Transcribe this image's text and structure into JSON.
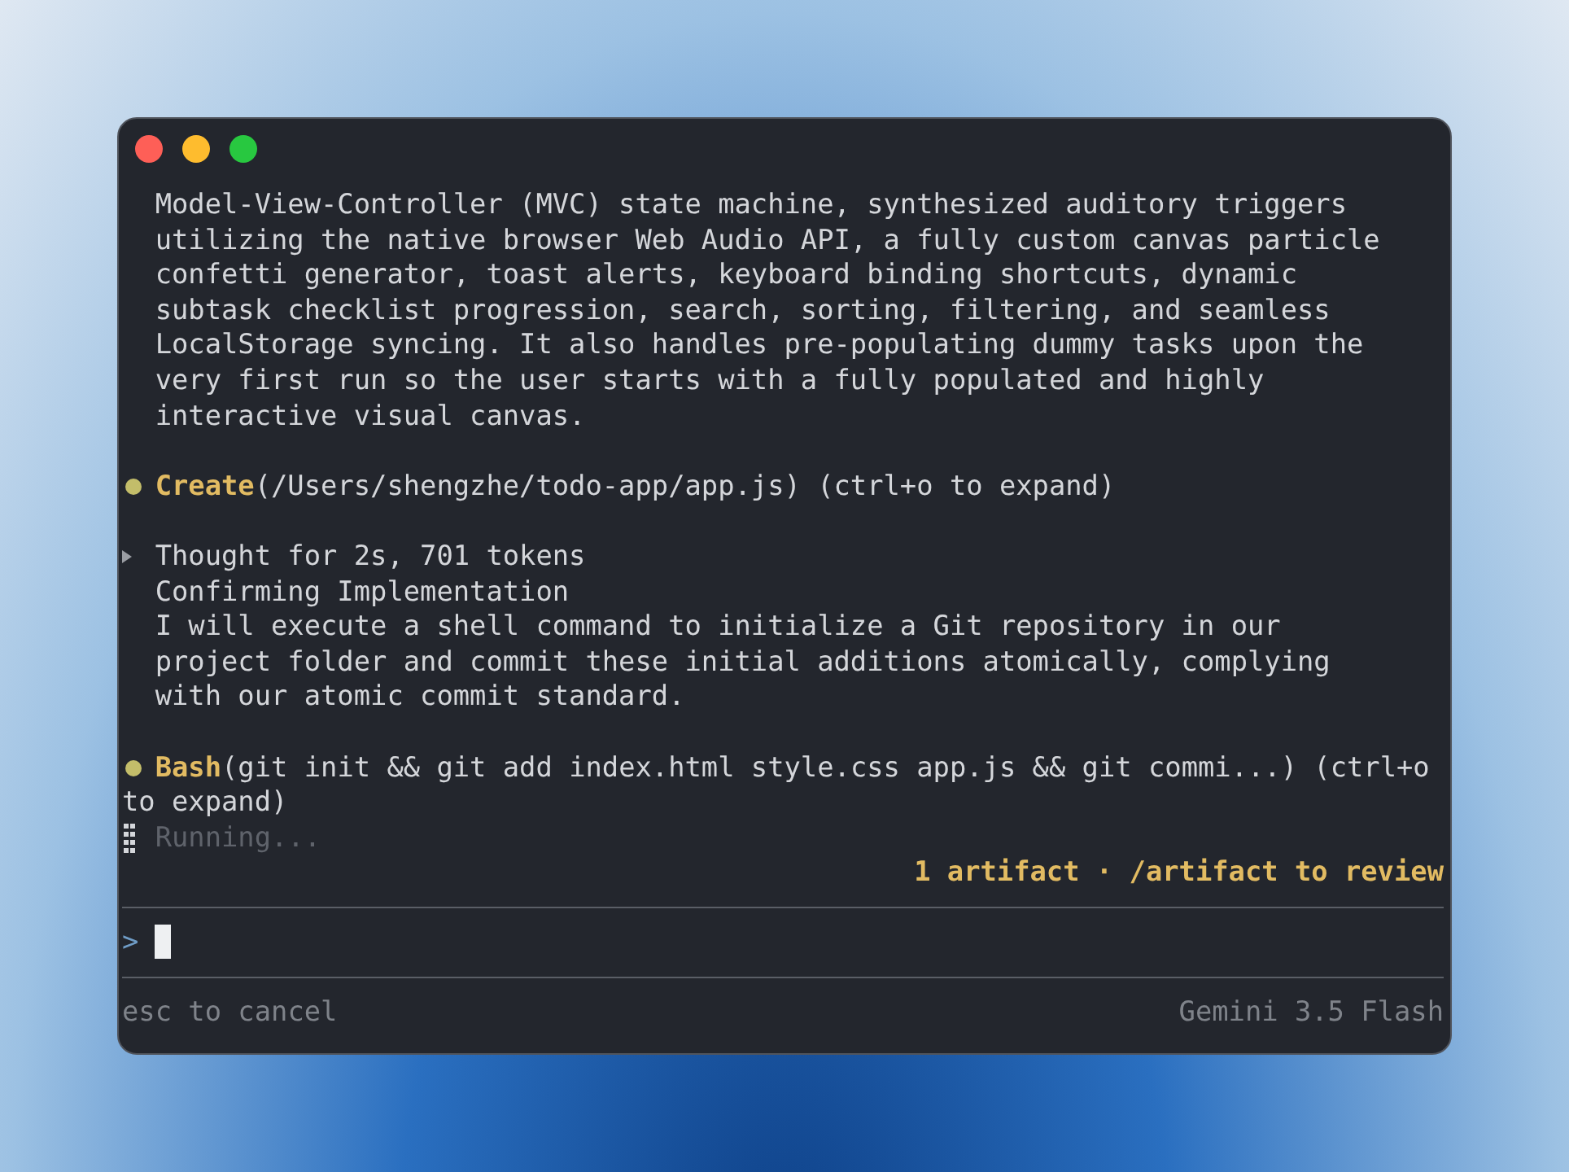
{
  "window": {
    "controls": [
      {
        "color": "#fe5f57"
      },
      {
        "color": "#febc2e"
      },
      {
        "color": "#28c840"
      }
    ]
  },
  "transcript": [
    {
      "kind": "message",
      "text": "Model-View-Controller (MVC) state machine, synthesized auditory triggers utilizing the native browser Web Audio API, a fully custom canvas particle confetti generator, toast alerts, keyboard binding shortcuts, dynamic subtask checklist progression, search, sorting, filtering, and seamless LocalStorage syncing. It also handles pre-populating dummy tasks upon the very first run so the user starts with a fully populated and highly interactive visual canvas."
    },
    {
      "kind": "tool_call",
      "lines": [
        "**Create**(/Users/shengzhe/todo-app/app.js) (ctrl+o to expand)"
      ]
    },
    {
      "kind": "thought",
      "summary": "Thought for 2s, 701 tokens",
      "title": "Confirming Implementation",
      "text": "I will execute a shell command to initialize a Git repository in our project folder and commit these initial additions atomically, complying with our atomic commit standard."
    },
    {
      "kind": "tool_call",
      "lines": [
        "**Bash**(git init && git add index.html style.css app.js && git commi...) (ctrl+o",
        "to expand)"
      ]
    },
    {
      "kind": "status",
      "text": "Running..."
    }
  ],
  "artifact_notice": "1 artifact · /artifact to review",
  "prompt": {
    "symbol": ">"
  },
  "footer": {
    "hint": "esc to cancel",
    "model": "Gemini 3.5 Flash"
  }
}
